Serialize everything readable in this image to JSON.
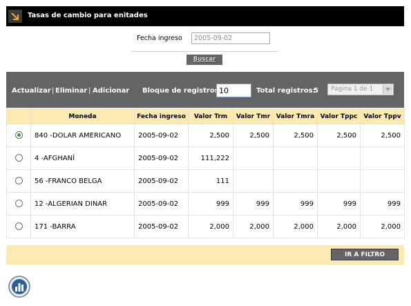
{
  "window": {
    "title": "Tasas de cambio para enitades"
  },
  "filter": {
    "fecha_label": "Fecha ingreso",
    "fecha_value": "2005-09-02",
    "buscar_label": "Buscar"
  },
  "toolbar": {
    "actualizar_label": "Actualizar",
    "eliminar_label": "Eliminar",
    "adicionar_label": "Adicionar",
    "separator": "|",
    "bloque_label": "Bloque de registros:",
    "bloque_value": "10",
    "total_label": "Total registros:",
    "total_value": "5",
    "pager_value": "Pagina 1 de 1"
  },
  "table": {
    "headers": [
      "Moneda",
      "Fecha ingreso",
      "Valor Trm",
      "Valor Tmr",
      "Valor Tmra",
      "Valor Tppc",
      "Valor Tppv"
    ],
    "rows": [
      {
        "selected": true,
        "cells": [
          "840 -DOLAR AMERICANO",
          "2005-09-02",
          "2,500",
          "2,500",
          "2,500",
          "2,500",
          "2,500"
        ]
      },
      {
        "selected": false,
        "cells": [
          "4 -AFGHANÍ",
          "2005-09-02",
          "111,222",
          "",
          "",
          "",
          ""
        ]
      },
      {
        "selected": false,
        "cells": [
          "56 -FRANCO BELGA",
          "2005-09-02",
          "111",
          "",
          "",
          "",
          ""
        ]
      },
      {
        "selected": false,
        "cells": [
          "12 -ALGERIAN DINAR",
          "2005-09-02",
          "999",
          "999",
          "999",
          "999",
          "999"
        ]
      },
      {
        "selected": false,
        "cells": [
          "171 -BARRA",
          "2005-09-02",
          "2,000",
          "2,000",
          "2,000",
          "2,000",
          "2,000"
        ]
      }
    ]
  },
  "footer": {
    "ir_a_filtro_label": "IR A FILTRO"
  },
  "icons": {
    "title_icon": "arrow-down-right-icon",
    "bottom_icon": "bar-chart-icon",
    "accent": "#f5a623",
    "header_bg": "#fdeab0"
  }
}
